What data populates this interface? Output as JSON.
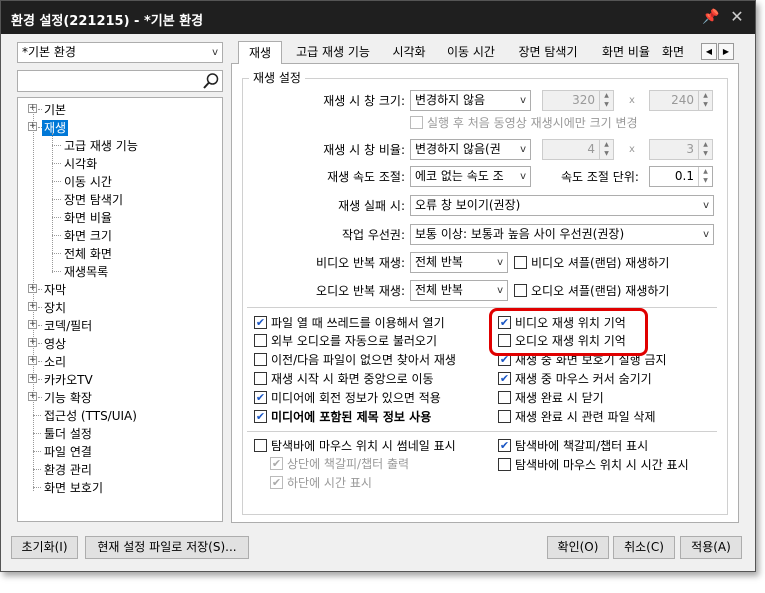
{
  "window": {
    "title": "환경 설정(221215) - *기본 환경",
    "pin_icon": "pin-icon",
    "close_icon": "close-icon"
  },
  "preset": {
    "value": "*기본 환경"
  },
  "search": {
    "value": "",
    "placeholder": ""
  },
  "tree": {
    "items": [
      {
        "label": "기본",
        "expandable": true
      },
      {
        "label": "재생",
        "expandable": true,
        "selected": true
      },
      {
        "label": "고급 재생 기능"
      },
      {
        "label": "시각화"
      },
      {
        "label": "이동 시간"
      },
      {
        "label": "장면 탐색기"
      },
      {
        "label": "화면 비율"
      },
      {
        "label": "화면 크기"
      },
      {
        "label": "전체 화면"
      },
      {
        "label": "재생목록"
      },
      {
        "label": "자막",
        "expandable": true
      },
      {
        "label": "장치",
        "expandable": true
      },
      {
        "label": "코덱/필터",
        "expandable": true
      },
      {
        "label": "영상",
        "expandable": true
      },
      {
        "label": "소리",
        "expandable": true
      },
      {
        "label": "카카오TV",
        "expandable": true
      },
      {
        "label": "기능 확장",
        "expandable": true
      },
      {
        "label": "접근성 (TTS/UIA)"
      },
      {
        "label": "툴더 설정"
      },
      {
        "label": "파일 연결"
      },
      {
        "label": "환경 관리"
      },
      {
        "label": "화면 보호기"
      }
    ]
  },
  "tabs": [
    {
      "label": "재생",
      "active": true
    },
    {
      "label": "고급 재생 기능"
    },
    {
      "label": "시각화"
    },
    {
      "label": "이동 시간"
    },
    {
      "label": "장면 탐색기"
    },
    {
      "label": "화면 비율"
    },
    {
      "label": "화면"
    }
  ],
  "group_title": "재생 설정",
  "settings": {
    "window_size": {
      "label": "재생 시 창 크기:",
      "value": "변경하지 않음",
      "width": "320",
      "x": "x",
      "height": "240"
    },
    "first_only": {
      "label": "실행 후 처음 동영상 재생시에만 크기 변경",
      "checked": false,
      "enabled": false
    },
    "window_ratio": {
      "label": "재생 시 창 비율:",
      "value": "변경하지 않음(권",
      "w": "4",
      "x": "x",
      "h": "3"
    },
    "speed": {
      "label": "재생 속도 조절:",
      "value": "에코 없는 속도 조",
      "unit_label": "속도 조절 단위:",
      "unit_value": "0.1"
    },
    "fail": {
      "label": "재생 실패 시:",
      "value": "오류 창 보이기(권장)"
    },
    "priority": {
      "label": "작업 우선권:",
      "value": "보통 이상: 보통과 높음 사이 우선권(권장)"
    },
    "video_repeat": {
      "label": "비디오 반복 재생:",
      "value": "전체 반복",
      "shuffle": "비디오 셔플(랜덤) 재생하기"
    },
    "audio_repeat": {
      "label": "오디오 반복 재생:",
      "value": "전체 반복",
      "shuffle": "오디오 셔플(랜덤) 재생하기"
    }
  },
  "checks_left": [
    {
      "label": "파일 열 때 쓰레드를 이용해서 열기",
      "checked": true
    },
    {
      "label": "외부 오디오를 자동으로 불러오기",
      "checked": false
    },
    {
      "label": "이전/다음 파일이 없으면 찾아서 재생",
      "checked": false
    },
    {
      "label": "재생 시작 시 화면 중앙으로 이동",
      "checked": false
    },
    {
      "label": "미디어에 회전 정보가 있으면 적용",
      "checked": true
    },
    {
      "label": "미디어에 포함된 제목 정보 사용",
      "checked": true,
      "bold": true
    }
  ],
  "checks_right": [
    {
      "label": "비디오 재생 위치 기억",
      "checked": true
    },
    {
      "label": "오디오 재생 위치 기억",
      "checked": false
    },
    {
      "label": "재생 중 화면 보호기 실행 금지",
      "checked": true
    },
    {
      "label": "재생 중 마우스 커서 숨기기",
      "checked": true
    },
    {
      "label": "재생 완료 시 닫기",
      "checked": false
    },
    {
      "label": "재생 완료 시 관련 파일 삭제",
      "checked": false
    }
  ],
  "seek_checks": {
    "thumb": {
      "label": "탐색바에 마우스 위치 시 썸네일 표시",
      "checked": false
    },
    "top_chapter": {
      "label": "상단에 책갈피/챕터 출력",
      "checked": true,
      "enabled": false
    },
    "bottom_time": {
      "label": "하단에 시간 표시",
      "checked": true,
      "enabled": false
    },
    "chapter": {
      "label": "탐색바에 책갈피/챕터 표시",
      "checked": true
    },
    "time": {
      "label": "탐색바에 마우스 위치 시 시간 표시",
      "checked": false
    }
  },
  "highlight_color": "#e00000",
  "footer": {
    "reset": "초기화(I)",
    "save": "현재 설정 파일로 저장(S)...",
    "ok": "확인(O)",
    "cancel": "취소(C)",
    "apply": "적용(A)"
  }
}
